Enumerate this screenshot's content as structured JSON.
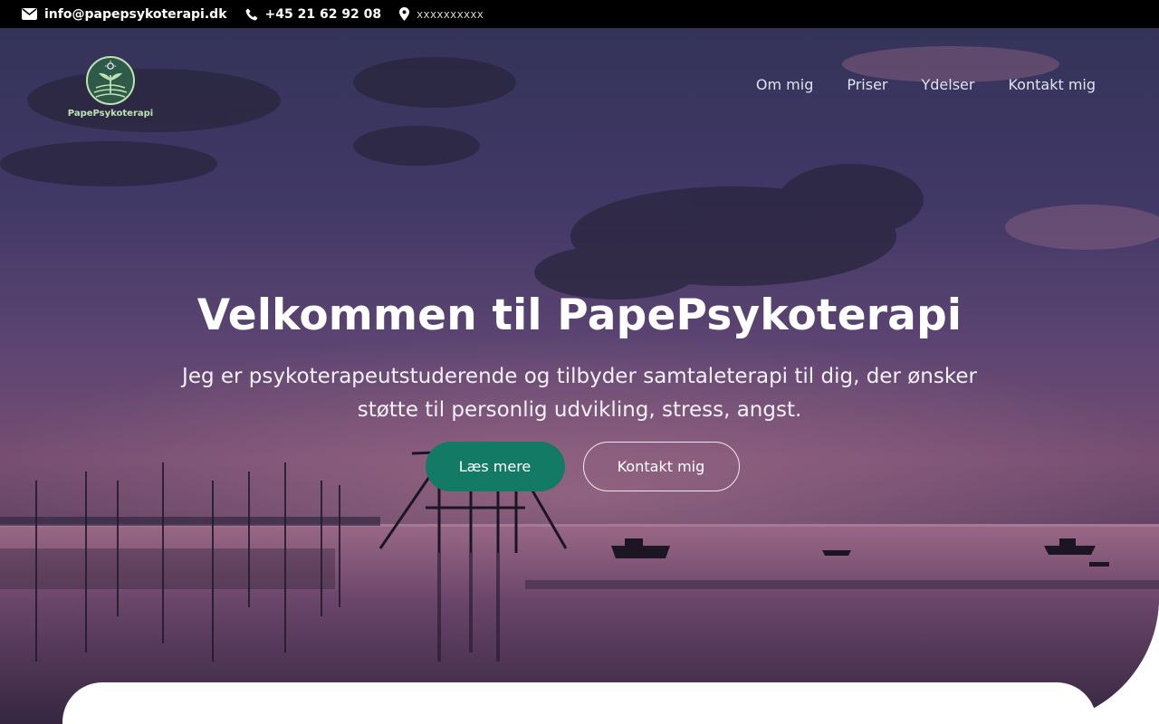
{
  "topbar": {
    "email": "info@papepsykoterapi.dk",
    "phone": "+45 21 62 92 08",
    "address": "xxxxxxxxxx"
  },
  "brand": {
    "name": "PapePsykoterapi"
  },
  "nav": {
    "items": [
      "Om mig",
      "Priser",
      "Ydelser",
      "Kontakt mig"
    ]
  },
  "hero": {
    "title": "Velkommen til PapePsykoterapi",
    "subtitle": "Jeg er psykoterapeutstuderende og tilbyder samtaleterapi til dig, der ønsker støtte til personlig udvikling, stress, angst.",
    "primary_button": "Læs mere",
    "secondary_button": "Kontakt mig"
  },
  "colors": {
    "topbar": "#000000",
    "accent": "#137a66",
    "logo_text": "#bfe3b0"
  }
}
